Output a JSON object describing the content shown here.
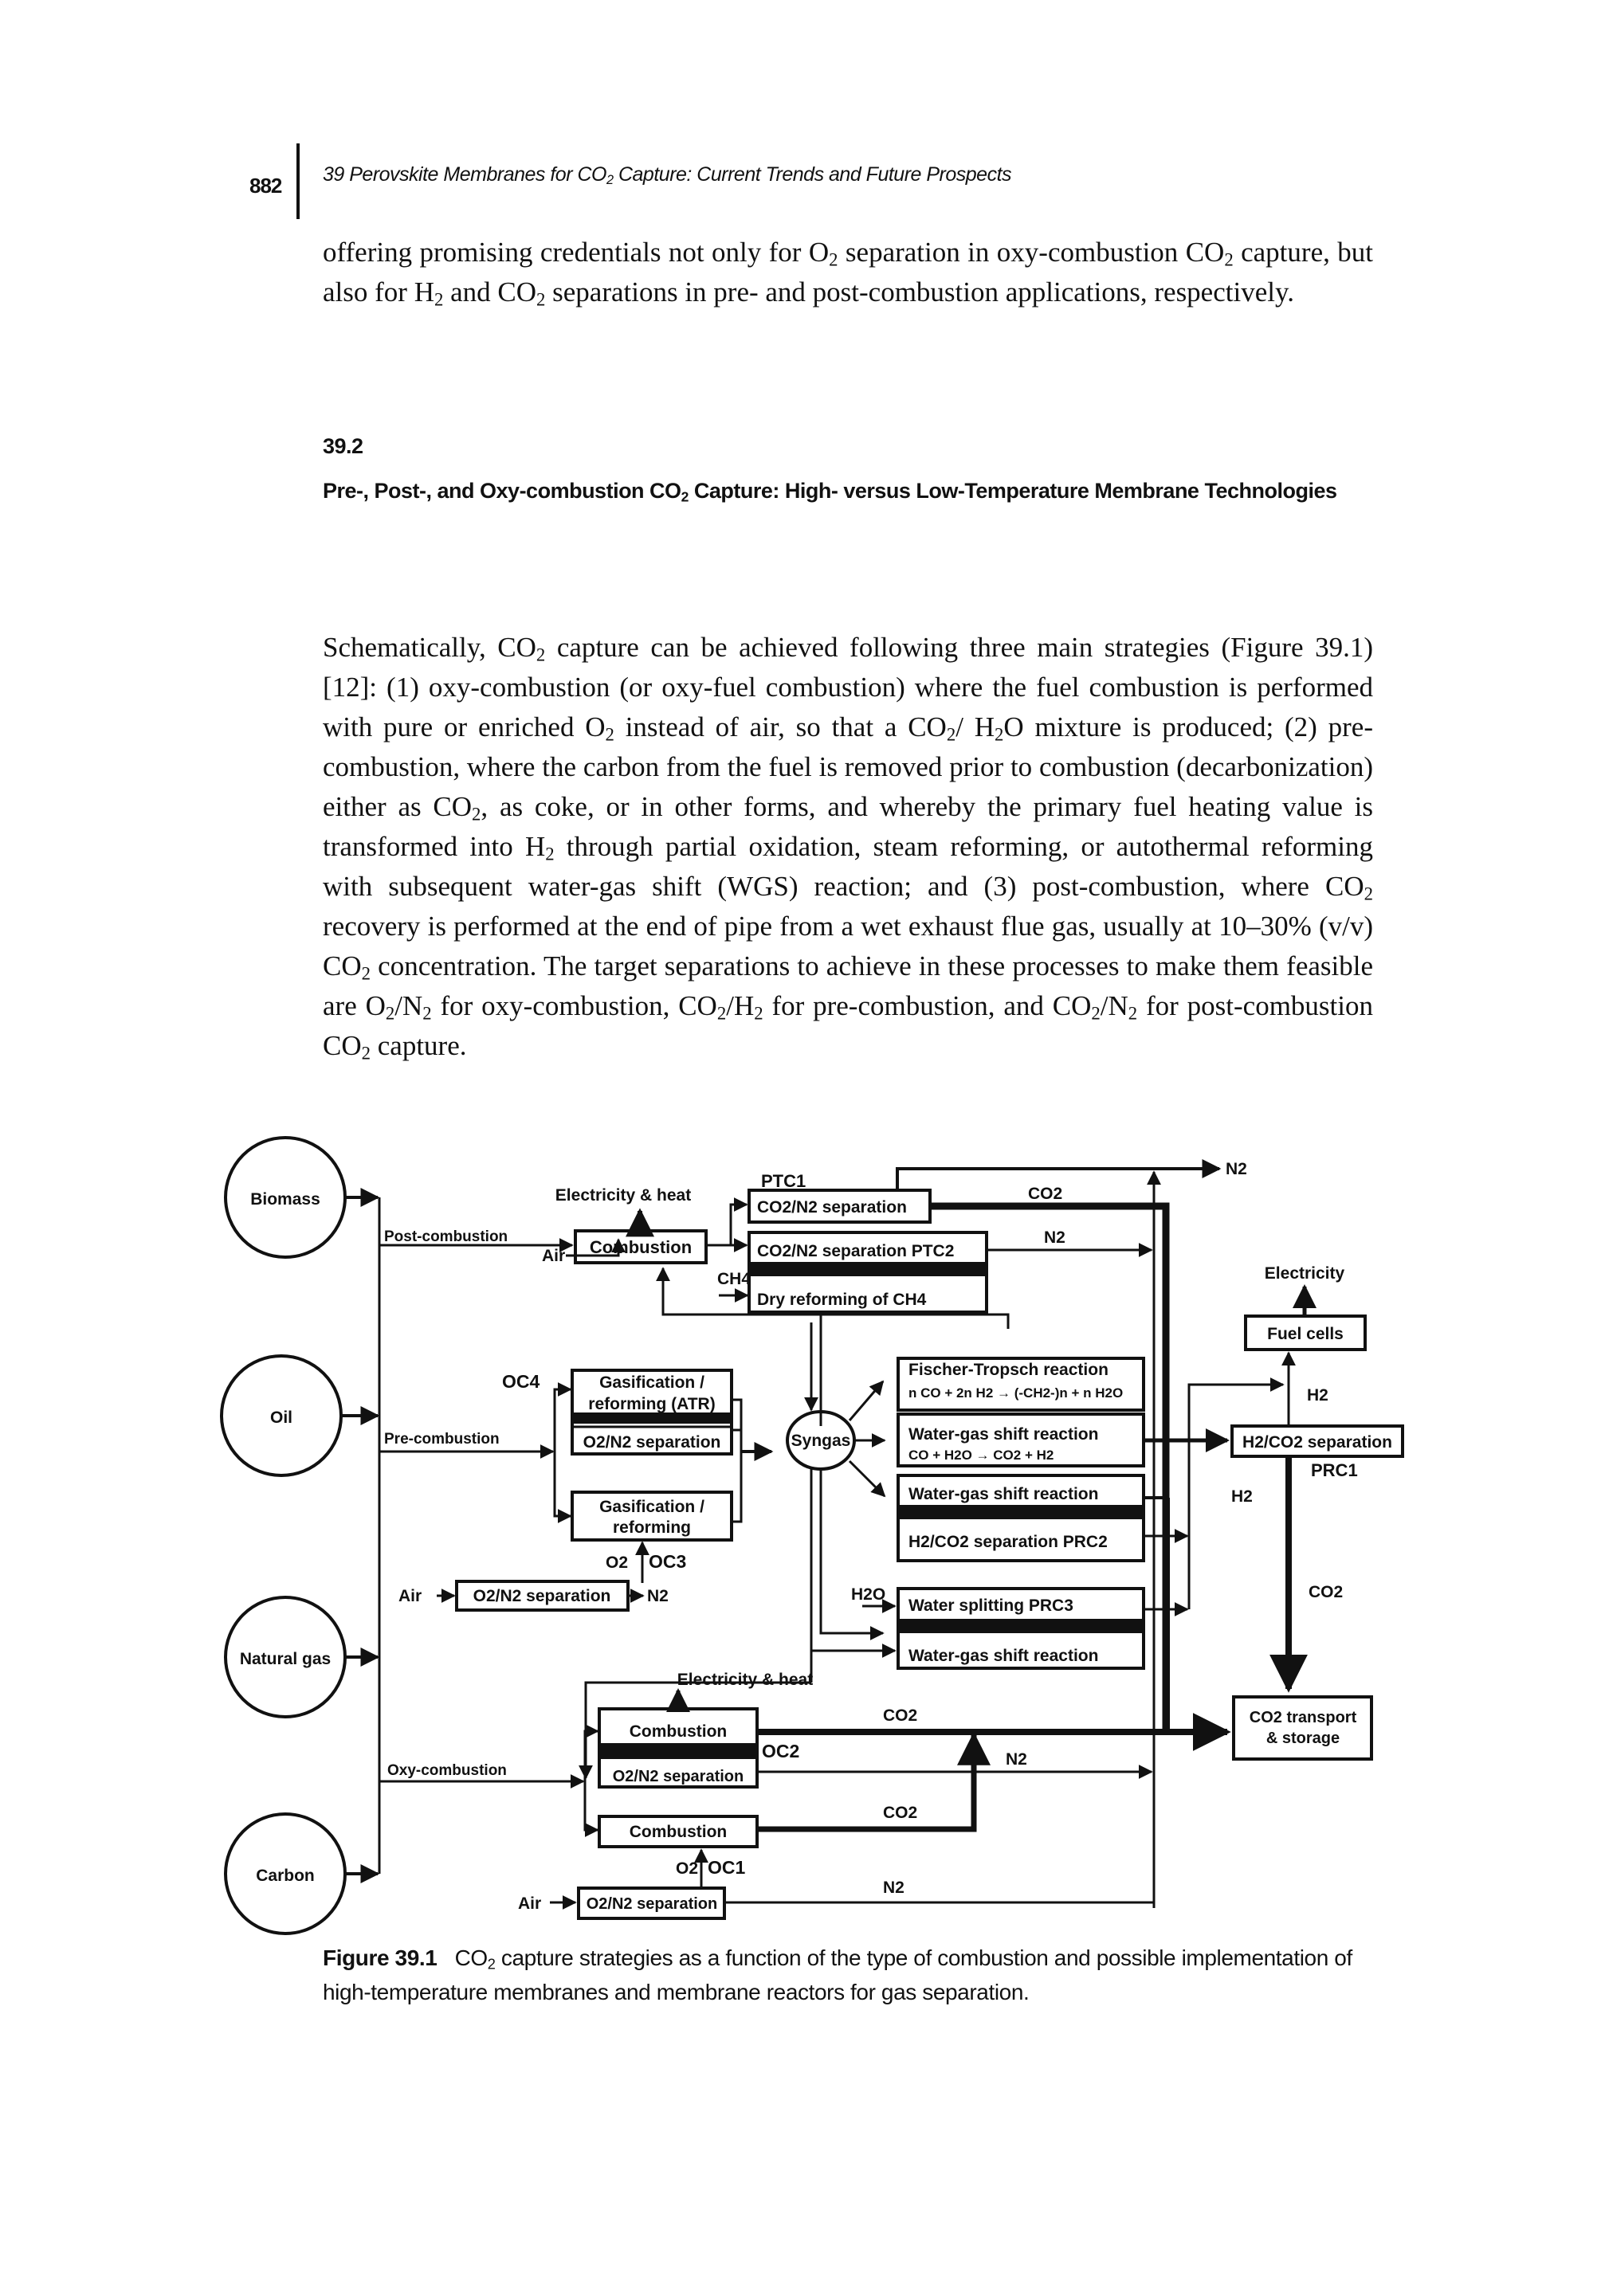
{
  "header": {
    "page_number": "882",
    "running_title_pre": "39  Perovskite Membranes for CO",
    "running_title_sub": "2",
    "running_title_post": " Capture: Current Trends and Future Prospects"
  },
  "paragraph1": [
    {
      "t": "offering promising credentials not only for O"
    },
    {
      "s": "2"
    },
    {
      "t": " separation in oxy-combustion CO"
    },
    {
      "s": "2"
    },
    {
      "t": " capture, but also for H"
    },
    {
      "s": "2"
    },
    {
      "t": " and CO"
    },
    {
      "s": "2"
    },
    {
      "t": " separations in pre- and post-combustion applications, respectively."
    }
  ],
  "section": {
    "number": "39.2",
    "title": [
      {
        "t": "Pre-, Post-, and Oxy-combustion CO"
      },
      {
        "s": "2"
      },
      {
        "t": " Capture: High- versus Low-Temperature Membrane Technologies"
      }
    ]
  },
  "paragraph2": [
    {
      "t": "Schematically, CO"
    },
    {
      "s": "2"
    },
    {
      "t": " capture can be achieved following three main strategies (Figure 39.1) [12]: (1) oxy-combustion (or oxy-fuel combustion) where the fuel combustion is performed with pure or enriched O"
    },
    {
      "s": "2"
    },
    {
      "t": " instead of air, so that a CO"
    },
    {
      "s": "2"
    },
    {
      "t": "/ H"
    },
    {
      "s": "2"
    },
    {
      "t": "O mixture is produced; (2) pre-combustion, where the carbon from the fuel is removed prior to combustion (decarbonization) either as CO"
    },
    {
      "s": "2"
    },
    {
      "t": ", as coke, or in other forms, and whereby the primary fuel heating value is transformed into H"
    },
    {
      "s": "2"
    },
    {
      "t": " through partial oxidation, steam reforming, or autothermal reforming with subsequent water-gas shift (WGS) reaction; and (3) post-combustion, where CO"
    },
    {
      "s": "2"
    },
    {
      "t": " recovery is performed at the end of pipe from a wet exhaust flue gas, usually at 10–30% (v/v) CO"
    },
    {
      "s": "2"
    },
    {
      "t": " concentration. The target separations to achieve in these processes to make them feasible are O"
    },
    {
      "s": "2"
    },
    {
      "t": "/N"
    },
    {
      "s": "2"
    },
    {
      "t": " for oxy-combustion, CO"
    },
    {
      "s": "2"
    },
    {
      "t": "/H"
    },
    {
      "s": "2"
    },
    {
      "t": " for pre-combustion, and CO"
    },
    {
      "s": "2"
    },
    {
      "t": "/N"
    },
    {
      "s": "2"
    },
    {
      "t": " for post-combustion CO"
    },
    {
      "s": "2"
    },
    {
      "t": " capture."
    }
  ],
  "figure": {
    "fuels": [
      "Biomass",
      "Oil",
      "Natural gas",
      "Carbon"
    ],
    "routes": {
      "post": "Post-combustion",
      "pre": "Pre-combustion",
      "oxy": "Oxy-combustion"
    },
    "labels": {
      "elec_heat": "Electricity & heat",
      "combustion": "Combustion",
      "air": "Air",
      "ptc1": "PTC1",
      "co2n2_sep": "CO2/N2 separation",
      "co2n2_sep_ptc2": "CO2/N2 separation PTC2",
      "dry_reforming": "Dry reforming of CH4",
      "ch4": "CH4",
      "co2": "CO2",
      "n2": "N2",
      "h2": "H2",
      "h2o": "H2O",
      "o2": "O2",
      "oc1": "OC1",
      "oc2": "OC2",
      "oc3": "OC3",
      "oc4": "OC4",
      "gasif_atr_1": "Gasification /",
      "gasif_atr_2": "reforming (ATR)",
      "o2n2_sep": "O2/N2  separation",
      "gasif_1": "Gasification /",
      "gasif_2": "reforming",
      "syngas": "Syngas",
      "ft": "Fischer-Tropsch reaction",
      "ft_eq": "n CO + 2n H2 → (-CH2-)n + n H2O",
      "wgs": "Water-gas shift reaction",
      "wgs_eq": "CO + H2O → CO2 + H2",
      "h2co2_prc2": "H2/CO2  separation PRC2",
      "water_split": "Water splitting PRC3",
      "electricity": "Electricity",
      "fuel_cells": "Fuel cells",
      "h2co2_sep": "H2/CO2  separation",
      "prc1": "PRC1",
      "co2_transport_1": "CO2 transport",
      "co2_transport_2": "& storage"
    }
  },
  "caption": {
    "label": "Figure 39.1",
    "text_pre": "CO",
    "text_sub": "2",
    "text_post": " capture strategies as a function of the type of combustion and possible implementation of high-temperature membranes and membrane reactors for gas separation."
  }
}
